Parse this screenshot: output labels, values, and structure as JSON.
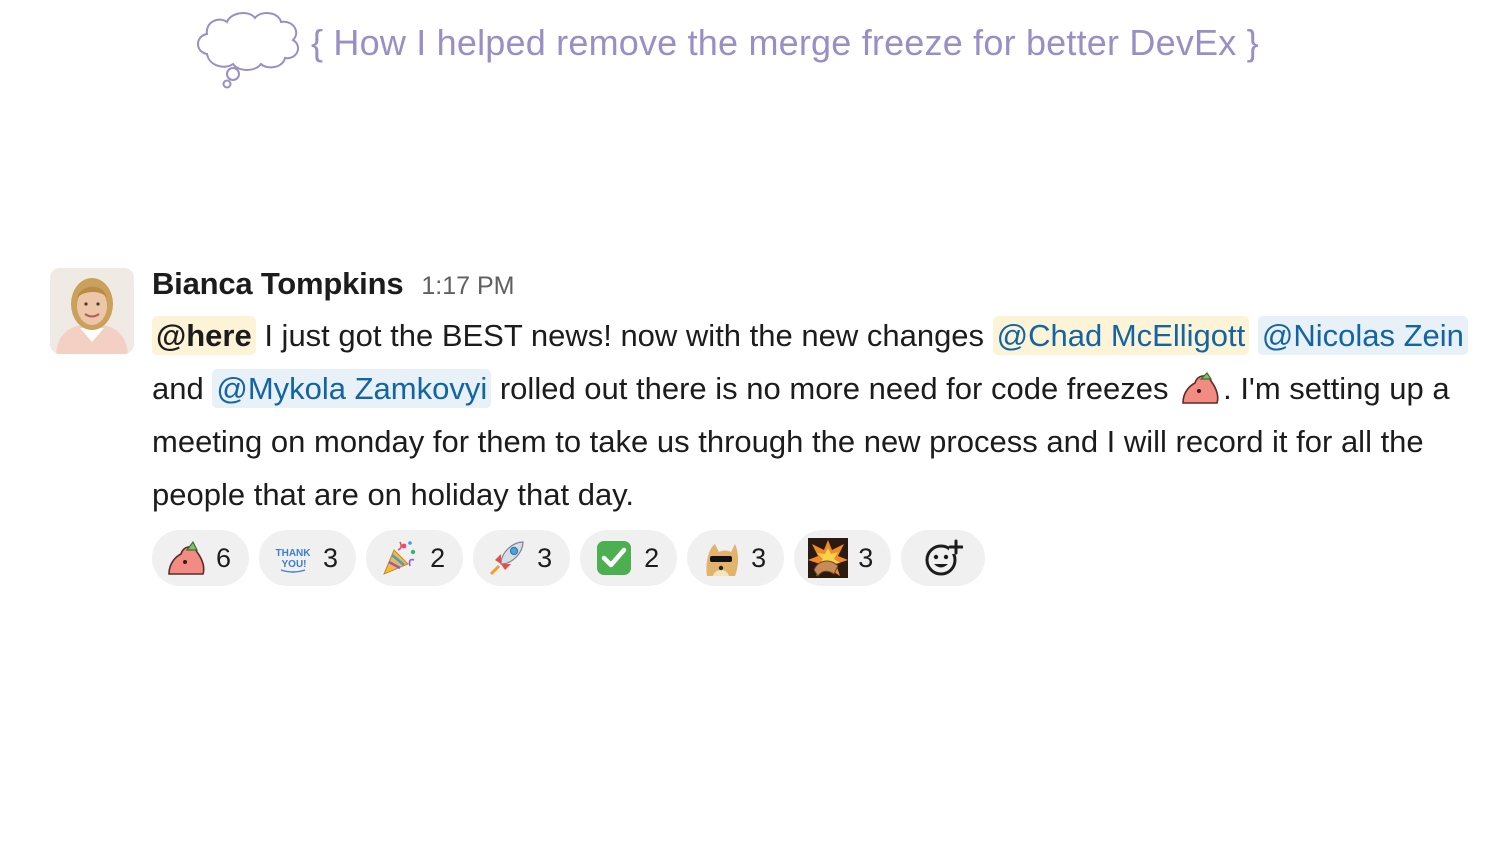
{
  "header": {
    "title": "{ How I helped remove the merge freeze for better DevEx }"
  },
  "message": {
    "sender": "Bianca Tompkins",
    "time": "1:17 PM",
    "here_mention": "@here",
    "text_1": " I just got the BEST news! now with the new changes ",
    "mention_1": "@Chad McElligott",
    "text_2": " ",
    "mention_2": "@Nicolas Zein",
    "text_3": " and ",
    "mention_3": "@Mykola Zamkovyi",
    "text_4": " rolled out there is no more need for code freezes ",
    "text_5": ".  I'm setting up a meeting on monday for them to take us through the new process and I will record it for all the people that are on holiday that day."
  },
  "reactions": [
    {
      "icon": "party-blob-icon",
      "count": "6"
    },
    {
      "icon": "thank-you-icon",
      "count": "3"
    },
    {
      "icon": "party-popper-icon",
      "count": "2"
    },
    {
      "icon": "rocket-icon",
      "count": "3"
    },
    {
      "icon": "check-mark-icon",
      "count": "2"
    },
    {
      "icon": "doge-sunglasses-icon",
      "count": "3"
    },
    {
      "icon": "explosion-fist-icon",
      "count": "3"
    }
  ],
  "colors": {
    "mention": "#1264a3",
    "mention_bg": "#e8f0f8",
    "here_bg": "#fdf4d8",
    "header": "#9a8fc4"
  }
}
